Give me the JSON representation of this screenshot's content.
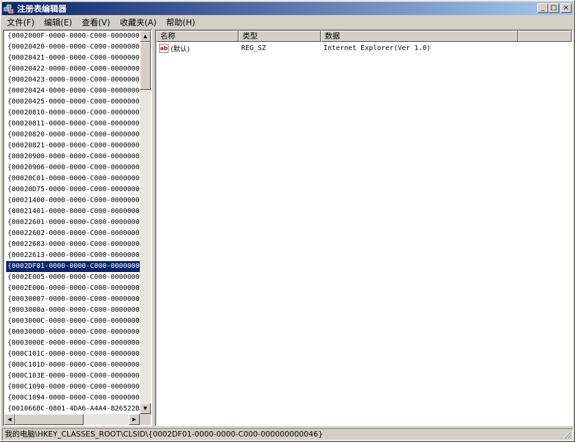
{
  "window": {
    "title": "注册表编辑器"
  },
  "title_buttons": {
    "minimize": "_",
    "maximize": "□",
    "close": "×"
  },
  "menu": {
    "items": [
      "文件(F)",
      "编辑(E)",
      "查看(V)",
      "收藏夹(A)",
      "帮助(H)"
    ]
  },
  "tree": {
    "items": [
      "{0002000F-0000-0000-C000-00000000",
      "{00020420-0000-0000-C000-00000000",
      "{00020421-0000-0000-C000-00000000",
      "{00020422-0000-0000-C000-00000000",
      "{00020423-0000-0000-C000-00000000",
      "{00020424-0000-0000-C000-00000000",
      "{00020425-0000-0000-C000-00000000",
      "{00020810-0000-0000-C000-00000000",
      "{00020811-0000-0000-C000-00000000",
      "{00020820-0000-0000-C000-00000000",
      "{00020821-0000-0000-C000-00000000",
      "{00020900-0000-0000-C000-00000000",
      "{00020906-0000-0000-C000-00000000",
      "{00020C01-0000-0000-C000-00000000",
      "{00020D75-0000-0000-C000-00000000",
      "{00021400-0000-0000-C000-00000000",
      "{00021401-0000-0000-C000-00000000",
      "{00022601-0000-0000-C000-00000000",
      "{00022602-0000-0000-C000-00000000",
      "{00022603-0000-0000-C000-00000000",
      "{00022613-0000-0000-C000-00000000",
      "{0002DF01-0000-0000-C000-00000000",
      "{0002E005-0000-0000-C000-00000000",
      "{0002E006-0000-0000-C000-00000000",
      "{00030007-0000-0000-C000-00000000",
      "{0003000a-0000-0000-C000-00000000",
      "{0003000C-0000-0000-C000-00000000",
      "{0003000D-0000-0000-C000-00000000",
      "{0003000E-0000-0000-C000-00000000",
      "{000C101C-0000-0000-C000-00000000",
      "{000C101D-0000-0000-C000-00000000",
      "{000C103E-0000-0000-C000-00000000",
      "{000C1090-0000-0000-C000-00000000",
      "{000C1094-0000-0000-C000-00000000",
      "{0010668C-0801-4DA6-A4A4-826522B6"
    ],
    "selected_index": 21
  },
  "columns": {
    "name": "名称",
    "type": "类型",
    "data": "数据"
  },
  "values": [
    {
      "name": "(默认)",
      "type": "REG_SZ",
      "data": "Internet Explorer(Ver 1.0)",
      "icon": "string-value-icon"
    }
  ],
  "statusbar": {
    "path": "我的电脑\\HKEY_CLASSES_ROOT\\CLSID\\{0002DF01-0000-0000-C000-000000000046}"
  },
  "colors": {
    "title_start": "#0a246a",
    "title_end": "#a6caf0",
    "selection": "#0a246a",
    "chrome": "#d4d0c8"
  }
}
